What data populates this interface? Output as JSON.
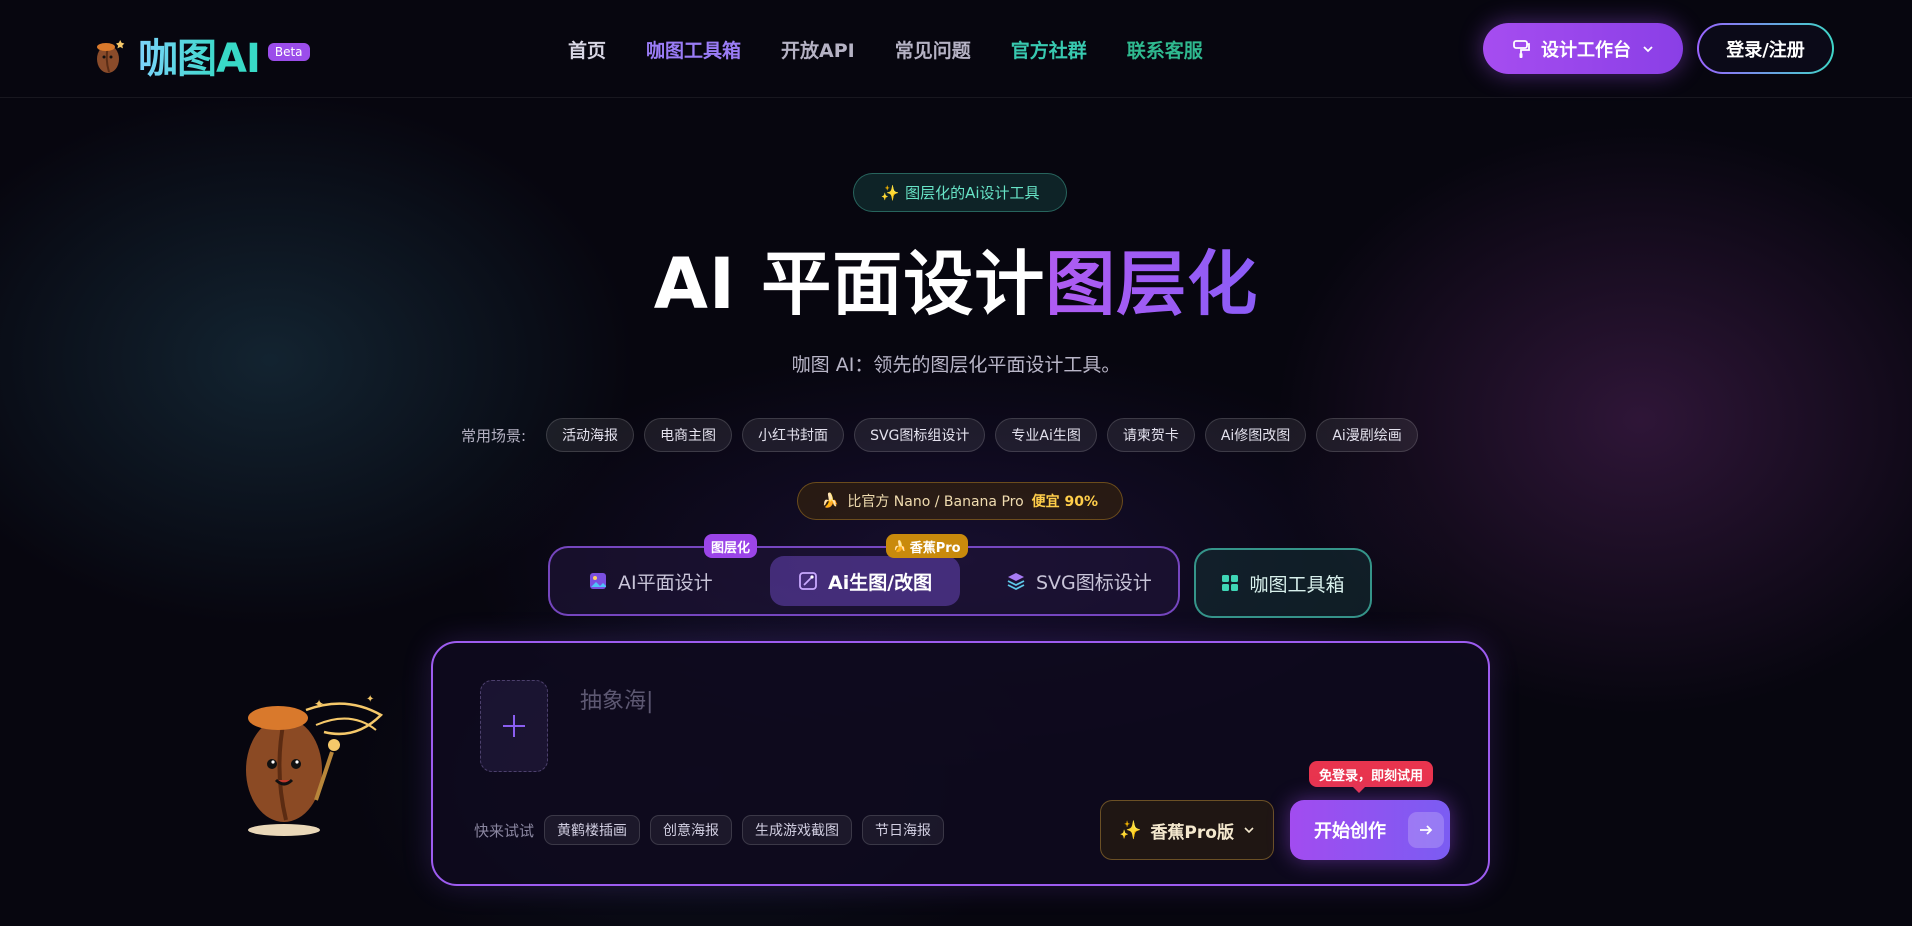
{
  "brand": {
    "name": "咖图AI",
    "badge": "Beta"
  },
  "nav": [
    {
      "label": "首页",
      "color": "#d8d6e4"
    },
    {
      "label": "咖图工具箱",
      "color": "#9a7cf6"
    },
    {
      "label": "开放API",
      "color": "#b5b2c4"
    },
    {
      "label": "常见问题",
      "color": "#b5b2c4"
    },
    {
      "label": "官方社群",
      "color": "#38c9b0"
    },
    {
      "label": "联系客服",
      "color": "#2fb98f"
    }
  ],
  "header": {
    "workspace_label": "设计工作台",
    "login_label": "登录/注册"
  },
  "hero": {
    "tagline": "图层化的Ai设计工具",
    "title_main": "AI 平面设计",
    "title_accent": "图层化",
    "subtitle": "咖图 AI：领先的图层化平面设计工具。"
  },
  "scenes": {
    "label": "常用场景:",
    "items": [
      "活动海报",
      "电商主图",
      "小红书封面",
      "SVG图标组设计",
      "专业Ai生图",
      "请柬贺卡",
      "Ai修图改图",
      "Ai漫剧绘画"
    ]
  },
  "promo": {
    "text": "比官方 Nano / Banana Pro",
    "highlight": "便宜 90%"
  },
  "modes": [
    {
      "label": "AI平面设计",
      "badge": "图层化"
    },
    {
      "label": "Ai生图/改图",
      "badge": "香蕉Pro"
    },
    {
      "label": "SVG图标设计",
      "badge": ""
    }
  ],
  "toolbox_label": "咖图工具箱",
  "prompt": {
    "typed_text": "抽象海|",
    "quick_label": "快来试试",
    "quick_items": [
      "黄鹤楼插画",
      "创意海报",
      "生成游戏截图",
      "节日海报"
    ],
    "model_label": "香蕉Pro版",
    "free_tag": "免登录，即刻试用",
    "start_label": "开始创作"
  },
  "colors": {
    "accent": "#9d5cf0",
    "teal": "#38c9b0",
    "gold": "#ffce4a",
    "red": "#e8344e"
  }
}
